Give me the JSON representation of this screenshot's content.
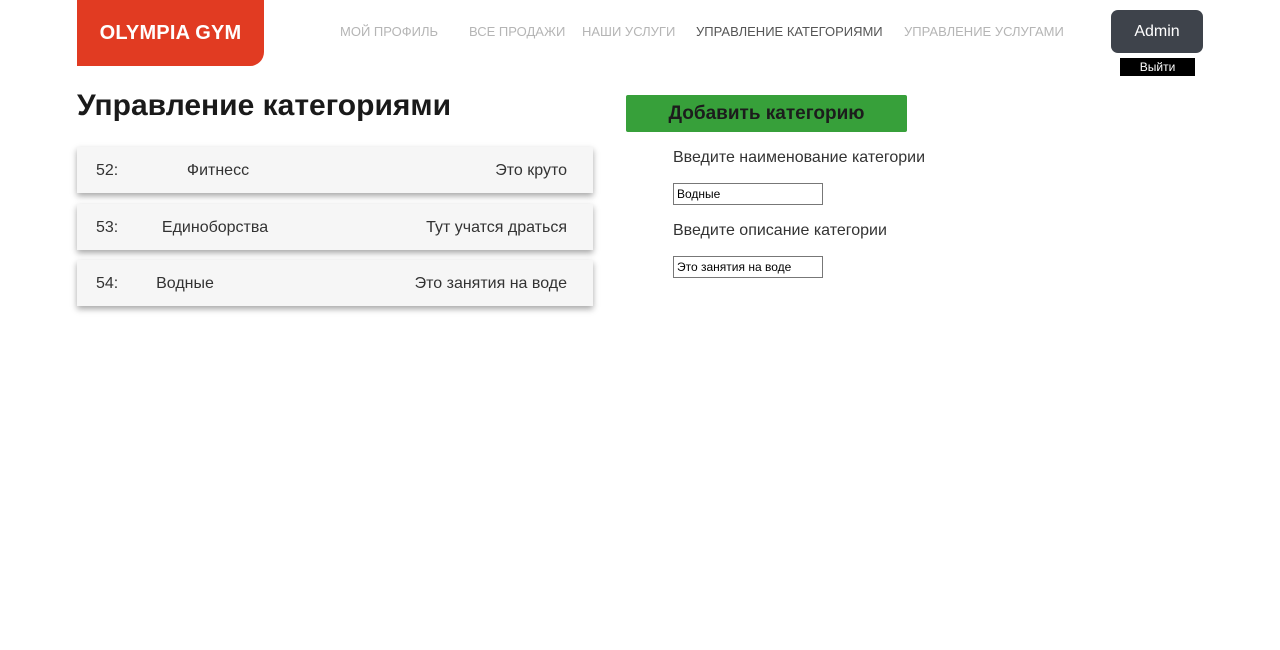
{
  "header": {
    "logo": "OLYMPIA GYM",
    "nav": [
      {
        "label": "МОЙ ПРОФИЛЬ"
      },
      {
        "label": "ВСЕ ПРОДАЖИ"
      },
      {
        "label": "НАШИ УСЛУГИ"
      },
      {
        "label": "УПРАВЛЕНИЕ КАТЕГОРИЯМИ",
        "active": true
      },
      {
        "label": "УПРАВЛЕНИЕ УСЛУГАМИ"
      }
    ],
    "user_button": "Admin",
    "logout_button": "Выйти"
  },
  "main": {
    "title": "Управление категориями",
    "categories": [
      {
        "id": "52:",
        "name": "Фитнесс",
        "description": "Это круто"
      },
      {
        "id": "53:",
        "name": "Единоборства",
        "description": "Тут учатся драться"
      },
      {
        "id": "54:",
        "name": "Водные",
        "description": "Это занятия на воде"
      }
    ]
  },
  "form": {
    "add_button": "Добавить категорию",
    "name_label": "Введите наименование категории",
    "name_value": "Водные",
    "description_label": "Введите описание категории",
    "description_value": "Это занятия на воде"
  },
  "colors": {
    "logo_bg": "#e13b22",
    "add_button_bg": "#37a03a",
    "admin_button_bg": "#3e434b"
  }
}
